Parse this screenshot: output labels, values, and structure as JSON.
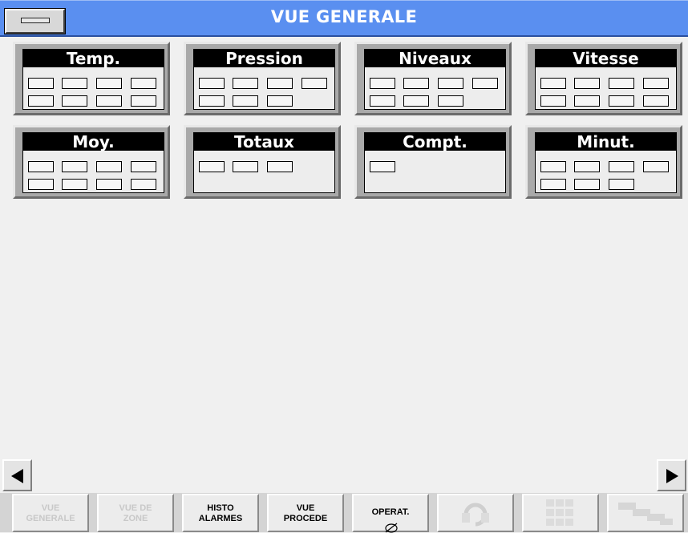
{
  "window": {
    "title": "VUE GENERALE",
    "title_bar_color": "#5a8ff0",
    "menu_icon": "minimize-bar-icon"
  },
  "panels": [
    {
      "title": "Temp.",
      "field_rows": [
        4,
        4
      ]
    },
    {
      "title": "Pression",
      "field_rows": [
        4,
        3
      ]
    },
    {
      "title": "Niveaux",
      "field_rows": [
        4,
        3
      ]
    },
    {
      "title": "Vitesse",
      "field_rows": [
        4,
        4
      ]
    },
    {
      "title": "Moy.",
      "field_rows": [
        4,
        4
      ]
    },
    {
      "title": "Totaux",
      "field_rows": [
        3
      ]
    },
    {
      "title": "Compt.",
      "field_rows": [
        1
      ]
    },
    {
      "title": "Minut.",
      "field_rows": [
        4,
        3
      ]
    }
  ],
  "scroll": {
    "left_icon": "triangle-left-icon",
    "right_icon": "triangle-right-icon"
  },
  "nav": {
    "vue_generale": {
      "line1": "VUE",
      "line2": "GENERALE",
      "enabled": false
    },
    "vue_de_zone": {
      "line1": "VUE DE",
      "line2": "ZONE",
      "enabled": false
    },
    "histo_alarmes": {
      "line1": "HISTO",
      "line2": "ALARMES",
      "enabled": true
    },
    "vue_procede": {
      "line1": "VUE",
      "line2": "PROCEDE",
      "enabled": true
    },
    "operat": {
      "label": "OPERAT.",
      "icon": "pencil-eraser-icon",
      "enabled": true
    },
    "btn6": {
      "icon": "circular-arrows-icon",
      "enabled": false
    },
    "btn7": {
      "icon": "grid-icon",
      "enabled": false
    },
    "btn8": {
      "icon": "stairs-icon",
      "enabled": false
    }
  }
}
